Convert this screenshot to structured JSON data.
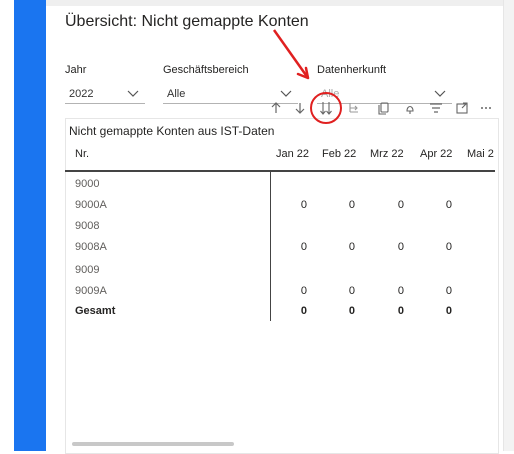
{
  "page": {
    "title": "Übersicht: Nicht gemappte Konten"
  },
  "slicers": {
    "jahr": {
      "label": "Jahr",
      "value": "2022"
    },
    "bereich": {
      "label": "Geschäftsbereich",
      "value": "Alle"
    },
    "herkunft": {
      "label": "Datenherkunft",
      "value": "Alle"
    }
  },
  "toolbar": {
    "icons": [
      "arrow-up-icon",
      "arrow-down-icon",
      "double-arrow-down-icon",
      "drill-icon",
      "copy-icon",
      "pin-icon",
      "filter-icon",
      "focus-mode-icon",
      "more-options-icon"
    ]
  },
  "matrix": {
    "title": "Nicht gemappte Konten aus IST-Daten",
    "col_first": "Nr.",
    "columns": [
      "Jan 22",
      "Feb 22",
      "Mrz 22",
      "Apr 22",
      "Mai 2"
    ],
    "rows": [
      {
        "label": "9000",
        "values": [
          "",
          "",
          "",
          ""
        ]
      },
      {
        "label": "9000A",
        "values": [
          "0",
          "0",
          "0",
          "0"
        ]
      },
      {
        "label": "9008",
        "values": [
          "",
          "",
          "",
          ""
        ]
      },
      {
        "label": "9008A",
        "values": [
          "0",
          "0",
          "0",
          "0"
        ]
      },
      {
        "label": "9009",
        "values": [
          "",
          "",
          "",
          ""
        ]
      },
      {
        "label": "9009A",
        "values": [
          "0",
          "0",
          "0",
          "0"
        ]
      }
    ],
    "total": {
      "label": "Gesamt",
      "values": [
        "0",
        "0",
        "0",
        "0"
      ]
    }
  },
  "colors": {
    "accent_bar": "#1a75f0",
    "annotation": "#e02020"
  }
}
